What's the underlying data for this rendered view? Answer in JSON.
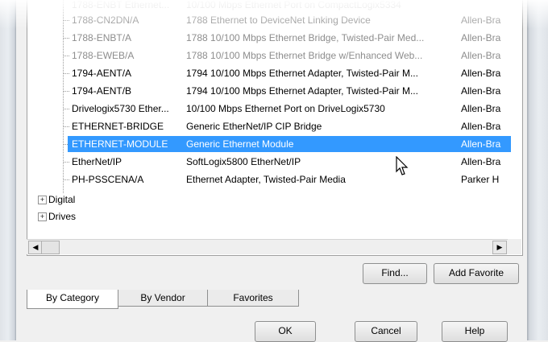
{
  "devices": [
    {
      "name": "1788-CN2DN/A",
      "description": "1788 Ethernet to DeviceNet Linking Device",
      "vendor": "Allen-Bra"
    },
    {
      "name": "1788-ENBT/A",
      "description": "1788 10/100 Mbps Ethernet Bridge, Twisted-Pair Med...",
      "vendor": "Allen-Bra"
    },
    {
      "name": "1788-EWEB/A",
      "description": "1788 10/100 Mbps Ethernet Bridge w/Enhanced Web...",
      "vendor": "Allen-Bra"
    },
    {
      "name": "1794-AENT/A",
      "description": "1794 10/100 Mbps Ethernet Adapter, Twisted-Pair M...",
      "vendor": "Allen-Bra"
    },
    {
      "name": "1794-AENT/B",
      "description": "1794 10/100 Mbps Ethernet Adapter, Twisted-Pair M...",
      "vendor": "Allen-Bra"
    },
    {
      "name": "Drivelogix5730 Ether...",
      "description": "10/100 Mbps Ethernet Port on DriveLogix5730",
      "vendor": "Allen-Bra"
    },
    {
      "name": "ETHERNET-BRIDGE",
      "description": "Generic EtherNet/IP CIP Bridge",
      "vendor": "Allen-Bra"
    },
    {
      "name": "ETHERNET-MODULE",
      "description": "Generic Ethernet Module",
      "vendor": "Allen-Bra"
    },
    {
      "name": "EtherNet/IP",
      "description": "SoftLogix5800 EtherNet/IP",
      "vendor": "Allen-Bra"
    },
    {
      "name": "PH-PSSCENA/A",
      "description": "Ethernet Adapter, Twisted-Pair Media",
      "vendor": "Parker H"
    }
  ],
  "categories": [
    {
      "label": "Digital",
      "expander": "+"
    },
    {
      "label": "Drives",
      "expander": "+"
    }
  ],
  "buttons": {
    "find": "Find...",
    "add_favorite": "Add Favorite",
    "ok": "OK",
    "cancel": "Cancel",
    "help": "Help"
  },
  "tabs": [
    "By Category",
    "By Vendor",
    "Favorites"
  ],
  "colors": {
    "selection": "#3399ff"
  }
}
